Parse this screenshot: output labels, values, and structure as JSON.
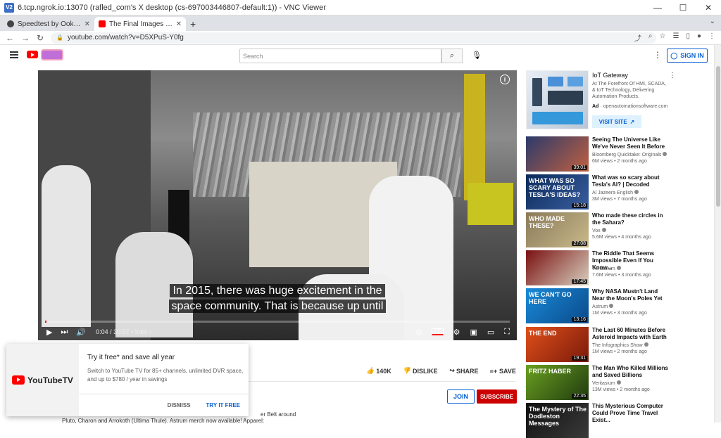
{
  "vnc": {
    "title": "6.tcp.ngrok.io:13070 (rafled_com's X desktop (cs-697003446807-default:1)) - VNC Viewer",
    "logo": "V2"
  },
  "browser": {
    "tabs": [
      {
        "title": "Speedtest by Ookla - The",
        "favicon_color": "#444444"
      },
      {
        "title": "The Final Images We Will",
        "favicon_color": "#ff0000"
      }
    ],
    "url": "youtube.com/watch?v=D5XPuS-Y0fg"
  },
  "masthead": {
    "search_placeholder": "Search",
    "signin": "SIGN IN"
  },
  "player": {
    "subtitle_line1": "In 2015, there was huge excitement in the",
    "subtitle_line2": "space community. That is because up until",
    "time": "0:04 / 30:57 • Intro ›",
    "progress": 0.002
  },
  "actions": {
    "likes": "140K",
    "dislike": "DISLIKE",
    "share": "SHARE",
    "save": "SAVE"
  },
  "channel": {
    "join": "JOIN",
    "subscribe": "SUBSCRIBE"
  },
  "description": {
    "line1": "er Belt around",
    "line2": "Pluto, Charon and Arrokoth (Ultima Thule). Astrum merch now available! Apparel:"
  },
  "promo": {
    "logo": "YouTubeTV",
    "title": "Try it free* and save all year",
    "text": "Switch to YouTube TV for 85+ channels, unlimited DVR space, and up to $780 / year in savings",
    "dismiss": "DISMISS",
    "try": "TRY IT FREE"
  },
  "ad": {
    "title": "IoT Gateway",
    "subtitle": "At The Forefront Of HMI, SCADA, & IoT Technology, Delivering Automation Products.",
    "badge": "Ad",
    "domain": "openautomationsoftware.com",
    "visit": "VISIT SITE"
  },
  "recommendations": [
    {
      "title": "Seeing The Universe Like We've Never Seen It Before",
      "channel": "Bloomberg Quicktake: Originals",
      "meta": "6M views • 2 months ago",
      "duration": "39:01",
      "thumb_text": "",
      "colors": [
        "#2b3a6b",
        "#c06040"
      ]
    },
    {
      "title": "What was so scary about Tesla's AI? | Decoded",
      "channel": "Al Jazeera English",
      "meta": "3M views • 7 months ago",
      "duration": "15:18",
      "thumb_text": "WHAT WAS SO SCARY ABOUT TESLA'S IDEAS?",
      "colors": [
        "#0b2a5a",
        "#3a5fa0"
      ]
    },
    {
      "title": "Who made these circles in the Sahara?",
      "channel": "Vox",
      "meta": "5.6M views • 4 months ago",
      "duration": "27:08",
      "thumb_text": "WHO MADE THESE?",
      "colors": [
        "#8a7a5a",
        "#c9b98a"
      ]
    },
    {
      "title": "The Riddle That Seems Impossible Even If You Know...",
      "channel": "Veritasium",
      "meta": "7.6M views • 3 months ago",
      "duration": "17:45",
      "thumb_text": "",
      "colors": [
        "#7a1010",
        "#d8d0c0"
      ]
    },
    {
      "title": "Why NASA Mustn't Land Near the Moon's Poles Yet",
      "channel": "Astrum",
      "meta": "1M views • 3 months ago",
      "duration": "13:16",
      "thumb_text": "WE CAN'T GO HERE",
      "colors": [
        "#1a8ad8",
        "#0a4a8a"
      ]
    },
    {
      "title": "The Last 60 Minutes Before Asteroid Impacts with Earth",
      "channel": "The Infographics Show",
      "meta": "1M views • 2 months ago",
      "duration": "19:31",
      "thumb_text": "THE END",
      "colors": [
        "#e0501a",
        "#7a1a0a"
      ]
    },
    {
      "title": "The Man Who Killed Millions and Saved Billions",
      "channel": "Veritasium",
      "meta": "13M views • 2 months ago",
      "duration": "22:35",
      "thumb_text": "FRITZ HABER",
      "colors": [
        "#6aa020",
        "#203a10"
      ]
    },
    {
      "title": "This Mysterious Computer Could Prove Time Travel Exist...",
      "channel": "",
      "meta": "",
      "duration": "",
      "thumb_text": "The Mystery of The Dodleston Messages",
      "colors": [
        "#101010",
        "#3a3a3a"
      ]
    }
  ]
}
